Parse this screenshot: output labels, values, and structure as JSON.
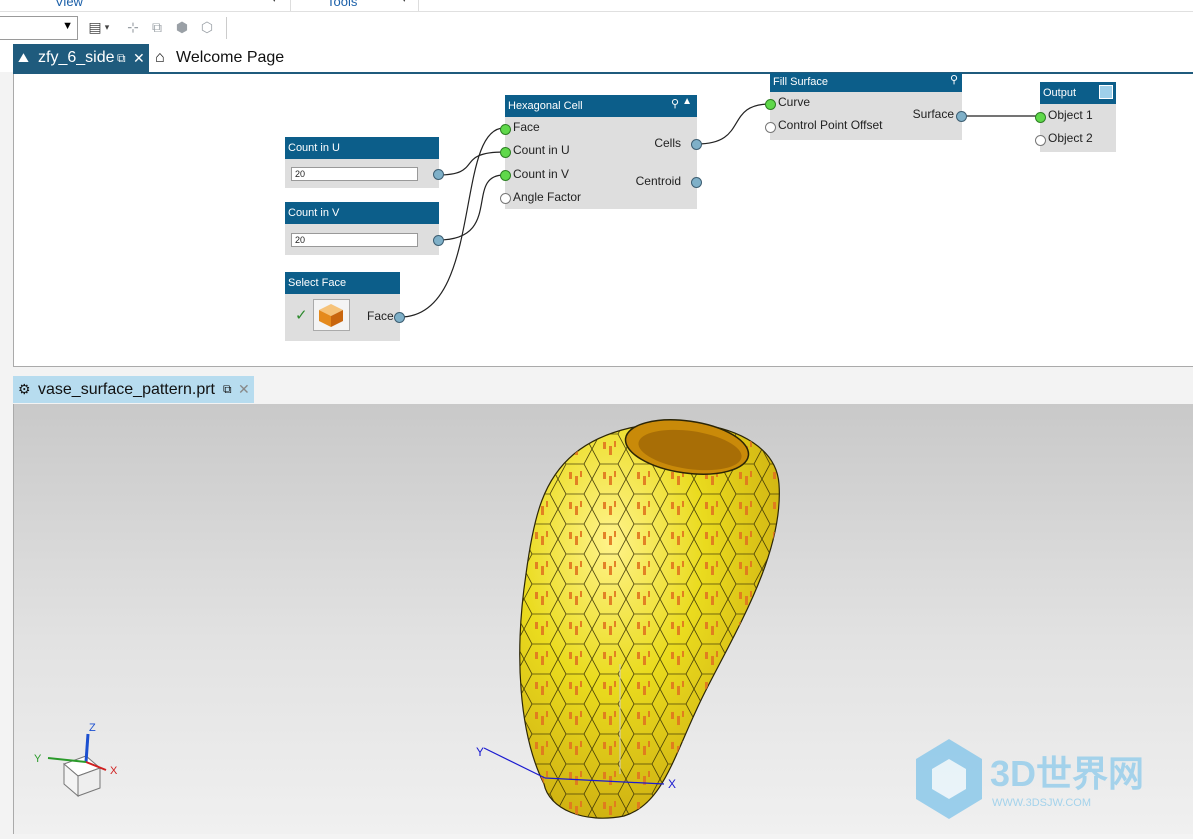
{
  "menu": {
    "view_label": "View",
    "tools_label": "Tools"
  },
  "toolbar": {
    "icons": [
      "layout-icon",
      "snap-icon",
      "node-icon",
      "cube-icon",
      "cube-small-icon"
    ]
  },
  "tabs": [
    {
      "label": "zfy_6_side",
      "active": true
    },
    {
      "label": "Welcome Page",
      "active": false
    }
  ],
  "nodes": {
    "count_u": {
      "title": "Count in U",
      "value": "20"
    },
    "count_v": {
      "title": "Count in V",
      "value": "20"
    },
    "select_face": {
      "title": "Select Face",
      "output": "Face"
    },
    "hex_cell": {
      "title": "Hexagonal Cell",
      "inputs": [
        "Face",
        "Count in U",
        "Count in V",
        "Angle Factor"
      ],
      "outputs": [
        "Cells",
        "Centroid"
      ]
    },
    "fill_surface": {
      "title": "Fill Surface",
      "inputs": [
        "Curve",
        "Control Point Offset"
      ],
      "outputs": [
        "Surface"
      ]
    },
    "output": {
      "title": "Output",
      "inputs": [
        "Object 1",
        "Object 2"
      ]
    }
  },
  "part_tab": {
    "label": "vase_surface_pattern.prt"
  },
  "viewport": {
    "triad_labels": [
      "Z",
      "Y",
      "X"
    ],
    "watermark": "3D世界网",
    "watermark_sub": "WWW.3DSJW.COM"
  },
  "colors": {
    "accent": "#0c5e8a",
    "tab_active": "#1f5b7d",
    "part_tab": "#b7dcef",
    "vase": "#e8d21a",
    "vase_pattern": "#e0761f"
  }
}
